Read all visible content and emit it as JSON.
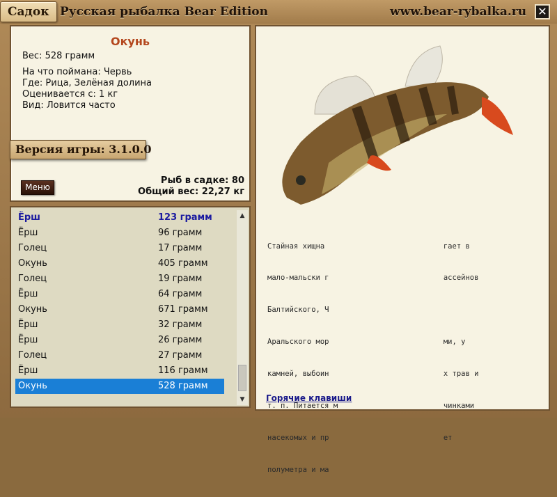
{
  "window": {
    "tab_label": "Садок",
    "title": "Русская рыбалка Bear Edition",
    "site": "www.bear-rybalka.ru",
    "close_glyph": "✕"
  },
  "fish": {
    "name": "Окунь",
    "weight": "Вес: 528 грамм",
    "bait": "На что поймана: Червь",
    "location": "Где: Рица, Зелёная долина",
    "valued": "Оценивается с: 1 кг",
    "rarity": "Вид: Ловится часто"
  },
  "version_label": "Версия игры: 3.1.0.0",
  "menu_label": "Меню",
  "stats": {
    "count": "Рыб в садке: 80",
    "total_weight": "Общий вес: 22,27 кг"
  },
  "catch_list": {
    "rows": [
      {
        "name": "Ёрш",
        "weight": "123 грамм",
        "state": "header"
      },
      {
        "name": "Ёрш",
        "weight": "96 грамм",
        "state": ""
      },
      {
        "name": "Голец",
        "weight": "17 грамм",
        "state": ""
      },
      {
        "name": "Окунь",
        "weight": "405 грамм",
        "state": ""
      },
      {
        "name": "Голец",
        "weight": "19 грамм",
        "state": ""
      },
      {
        "name": "Ёрш",
        "weight": "64 грамм",
        "state": ""
      },
      {
        "name": "Окунь",
        "weight": "671 грамм",
        "state": ""
      },
      {
        "name": "Ёрш",
        "weight": "32 грамм",
        "state": ""
      },
      {
        "name": "Ёрш",
        "weight": "26 грамм",
        "state": ""
      },
      {
        "name": "Голец",
        "weight": "27 грамм",
        "state": ""
      },
      {
        "name": "Ёрш",
        "weight": "116 грамм",
        "state": ""
      },
      {
        "name": "Окунь",
        "weight": "528 грамм",
        "state": "selected"
      }
    ],
    "scroll_up": "▲",
    "scroll_down": "▼"
  },
  "description": {
    "lines": [
      "Стайная хищна                           гает в",
      "мало-мальски г                          ассейнов",
      "Балтийского, Ч",
      "Аральского мор                          ми, у",
      "камней, выбоин                          х трав и",
      "т. п. Питается м                        чинками",
      "насекомых и пр                          ет",
      "полуметра и ма"
    ]
  },
  "hotkeys_link": "Горячие клавиши",
  "colors": {
    "accent_red": "#b4471e",
    "header_blue": "#1b1aa0",
    "selection": "#1a7fd6"
  }
}
